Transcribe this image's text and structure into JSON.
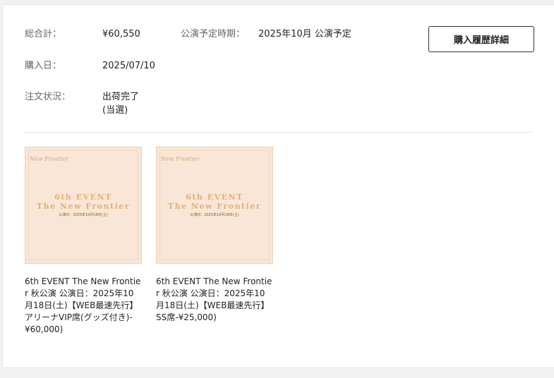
{
  "order": {
    "total_label": "総合計：",
    "total_value": "¥60,550",
    "schedule_label": "公演予定時期：",
    "schedule_value": "2025年10月 公演予定",
    "date_label": "購入日：",
    "date_value": "2025/07/10",
    "status_label": "注文状況：",
    "status_line1": "出荷完了",
    "status_line2": "(当選)",
    "history_button": "購入履歴詳細"
  },
  "products": [
    {
      "thumb_logo": "New Frontier",
      "thumb_line1": "6th EVENT",
      "thumb_line2": "The New Frontier",
      "thumb_line3": "公演日：2025年10月18日(土)",
      "name": "6th EVENT The New Frontier 秋公演 公演日：2025年10月18日(土)【WEB最速先行】アリーナVIP席(グッズ付き)-¥60,000)"
    },
    {
      "thumb_logo": "New Frontier",
      "thumb_line1": "6th EVENT",
      "thumb_line2": "The New Frontier",
      "thumb_line3": "公演日：2025年10月18日(土)",
      "name": "6th EVENT The New Frontier 秋公演 公演日：2025年10月18日(土)【WEB最速先行】SS席-¥25,000)"
    }
  ]
}
